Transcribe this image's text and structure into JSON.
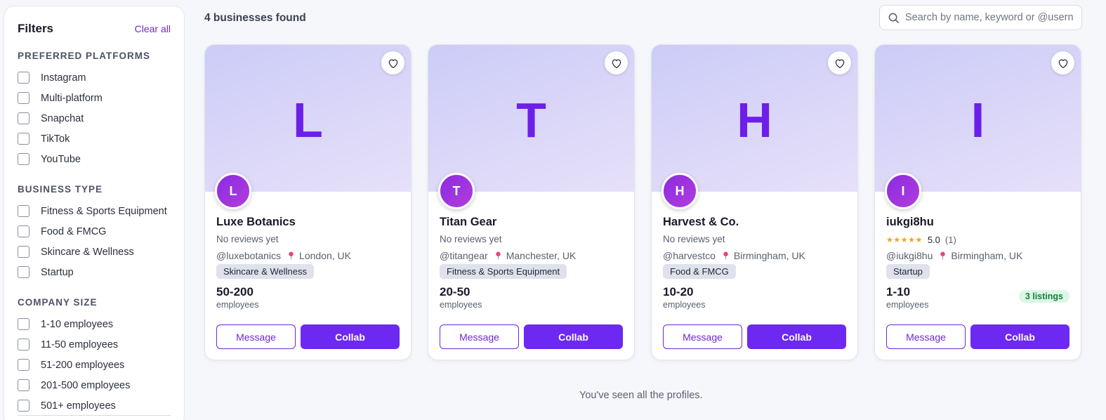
{
  "sidebar": {
    "title": "Filters",
    "clear_all": "Clear all",
    "sections": [
      {
        "title": "PREFERRED PLATFORMS",
        "options": [
          "Instagram",
          "Multi-platform",
          "Snapchat",
          "TikTok",
          "YouTube"
        ]
      },
      {
        "title": "BUSINESS TYPE",
        "options": [
          "Fitness & Sports Equipment",
          "Food & FMCG",
          "Skincare & Wellness",
          "Startup"
        ]
      },
      {
        "title": "COMPANY SIZE",
        "options": [
          "1-10 employees",
          "11-50 employees",
          "51-200 employees",
          "201-500 employees",
          "501+ employees"
        ]
      }
    ]
  },
  "header": {
    "results_count": "4 businesses found",
    "search_placeholder": "Search by name, keyword or @username"
  },
  "cards": [
    {
      "letter": "L",
      "name": "Luxe Botanics",
      "reviews": "No reviews yet",
      "handle": "@luxebotanics",
      "location": "London, UK",
      "tag": "Skincare & Wellness",
      "size": "50-200",
      "size_label": "employees",
      "message": "Message",
      "collab": "Collab"
    },
    {
      "letter": "T",
      "name": "Titan Gear",
      "reviews": "No reviews yet",
      "handle": "@titangear",
      "location": "Manchester, UK",
      "tag": "Fitness & Sports Equipment",
      "size": "20-50",
      "size_label": "employees",
      "message": "Message",
      "collab": "Collab"
    },
    {
      "letter": "H",
      "name": "Harvest & Co.",
      "reviews": "No reviews yet",
      "handle": "@harvestco",
      "location": "Birmingham, UK",
      "tag": "Food & FMCG",
      "size": "10-20",
      "size_label": "employees",
      "message": "Message",
      "collab": "Collab"
    },
    {
      "letter": "I",
      "name": "iukgi8hu",
      "rating_stars": "★★★★★",
      "rating_value": "5.0",
      "rating_count": "(1)",
      "handle": "@iukgi8hu",
      "location": "Birmingham, UK",
      "tag": "Startup",
      "size": "1-10",
      "size_label": "employees",
      "listings": "3 listings",
      "message": "Message",
      "collab": "Collab"
    }
  ],
  "footer": {
    "end_note": "You've seen all the profiles."
  },
  "colors": {
    "accent": "#6d28f2",
    "banner_letter": "#6d1fe8",
    "listings_badge_text": "#15803d",
    "listings_badge_bg": "#dcf7e5",
    "star": "#f0a51f"
  },
  "icons": {
    "search": "search-icon",
    "favorite": "heart-icon",
    "location": "location-pin-icon"
  }
}
